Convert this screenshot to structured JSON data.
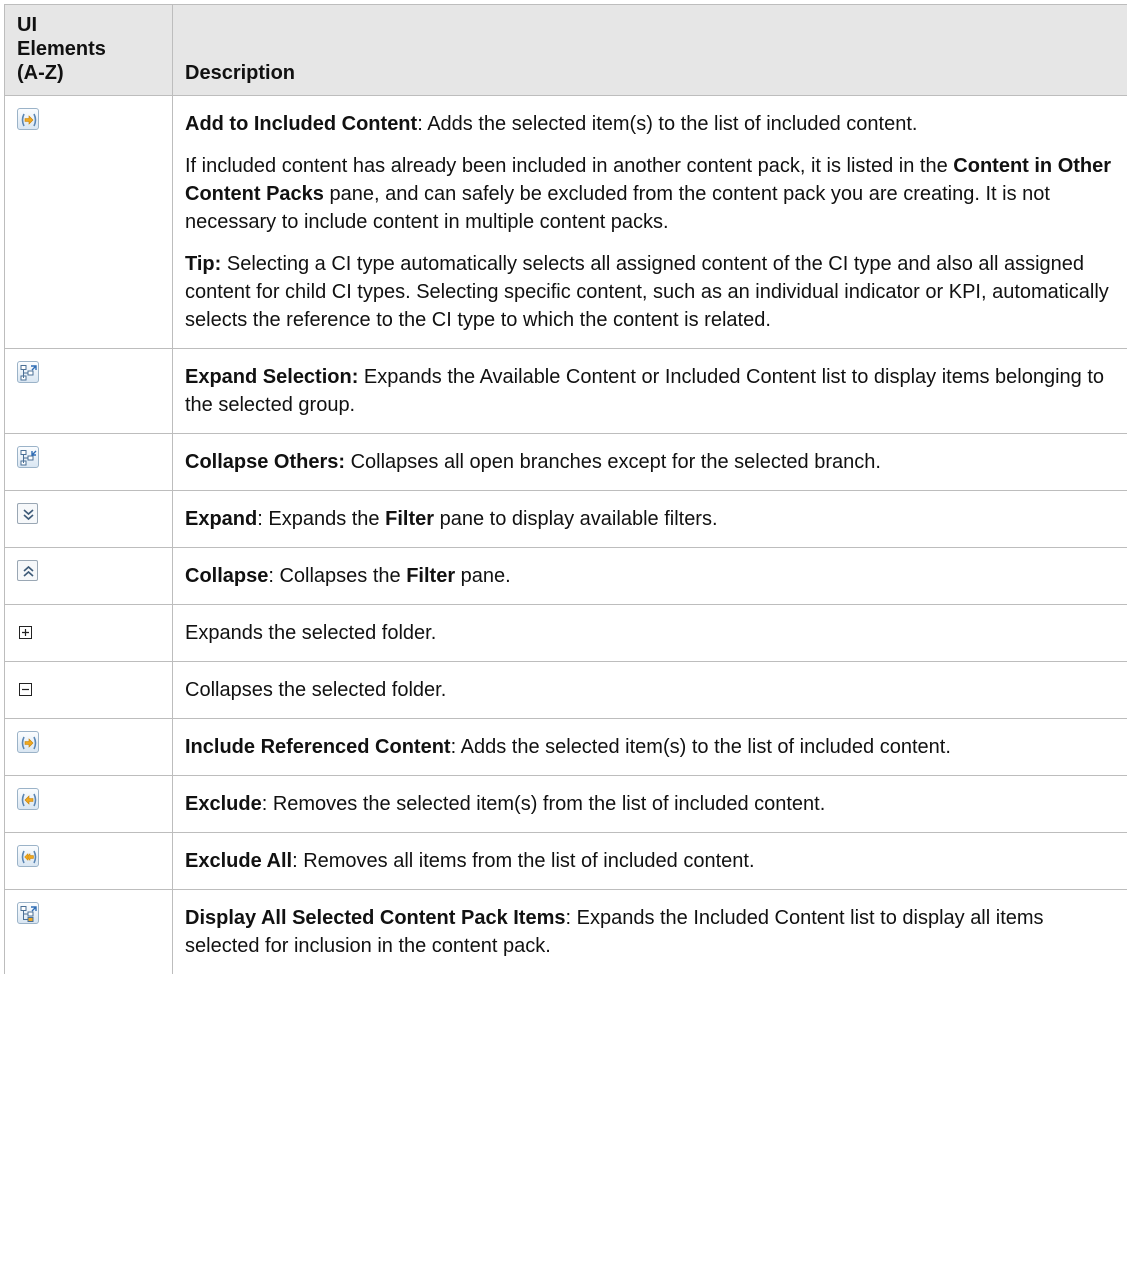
{
  "header": {
    "col1": "UI Elements (A-Z)",
    "col1_lines": [
      "UI",
      "Elements",
      "(A-Z)"
    ],
    "col2": "Description"
  },
  "rows": [
    {
      "icon": "add-arrow-right-icon",
      "paragraphs": [
        [
          {
            "b": true,
            "t": "Add to Included Content"
          },
          {
            "t": ": Adds the selected item(s) to the list of included content."
          }
        ],
        [
          {
            "t": "If included content has already been included in another content pack, it is listed in the "
          },
          {
            "b": true,
            "t": "Content in Other Content Packs"
          },
          {
            "t": " pane, and can safely be excluded from the content pack you are creating. It is not necessary to include content in multiple content packs."
          }
        ],
        [
          {
            "b": true,
            "t": "Tip:"
          },
          {
            "t": " Selecting a CI type automatically selects all assigned content of the CI type and also all assigned content for child CI types. Selecting specific content, such as an individual indicator or KPI, automatically selects the reference to the CI type to which the content is related."
          }
        ]
      ]
    },
    {
      "icon": "expand-selection-icon",
      "paragraphs": [
        [
          {
            "b": true,
            "t": "Expand Selection:"
          },
          {
            "t": " Expands the Available Content or Included Content list to display items belonging to the selected group."
          }
        ]
      ]
    },
    {
      "icon": "collapse-others-icon",
      "paragraphs": [
        [
          {
            "b": true,
            "t": "Collapse Others:"
          },
          {
            "t": " Collapses all open branches except for the selected branch."
          }
        ]
      ]
    },
    {
      "icon": "expand-chevron-down-icon",
      "paragraphs": [
        [
          {
            "b": true,
            "t": "Expand"
          },
          {
            "t": ": Expands the "
          },
          {
            "b": true,
            "t": "Filter"
          },
          {
            "t": " pane to display available filters."
          }
        ]
      ]
    },
    {
      "icon": "collapse-chevron-up-icon",
      "paragraphs": [
        [
          {
            "b": true,
            "t": "Collapse"
          },
          {
            "t": ": Collapses the "
          },
          {
            "b": true,
            "t": "Filter"
          },
          {
            "t": " pane."
          }
        ]
      ]
    },
    {
      "icon": "plus-box-icon",
      "paragraphs": [
        [
          {
            "t": "Expands the selected folder."
          }
        ]
      ]
    },
    {
      "icon": "minus-box-icon",
      "paragraphs": [
        [
          {
            "t": "Collapses the selected folder."
          }
        ]
      ]
    },
    {
      "icon": "include-referenced-arrow-icon",
      "paragraphs": [
        [
          {
            "b": true,
            "t": "Include Referenced Content"
          },
          {
            "t": ": Adds the selected item(s) to the list of included content."
          }
        ]
      ]
    },
    {
      "icon": "exclude-arrow-left-icon",
      "paragraphs": [
        [
          {
            "b": true,
            "t": "Exclude"
          },
          {
            "t": ": Removes the selected item(s) from the list of included content."
          }
        ]
      ]
    },
    {
      "icon": "exclude-all-double-arrow-icon",
      "paragraphs": [
        [
          {
            "b": true,
            "t": "Exclude All"
          },
          {
            "t": ": Removes all items from the list of included content."
          }
        ]
      ]
    },
    {
      "icon": "display-all-selected-icon",
      "paragraphs": [
        [
          {
            "b": true,
            "t": "Display All Selected Content Pack Items"
          },
          {
            "t": ": Expands the Included Content list to display all items selected for inclusion in the content pack."
          }
        ]
      ]
    }
  ]
}
